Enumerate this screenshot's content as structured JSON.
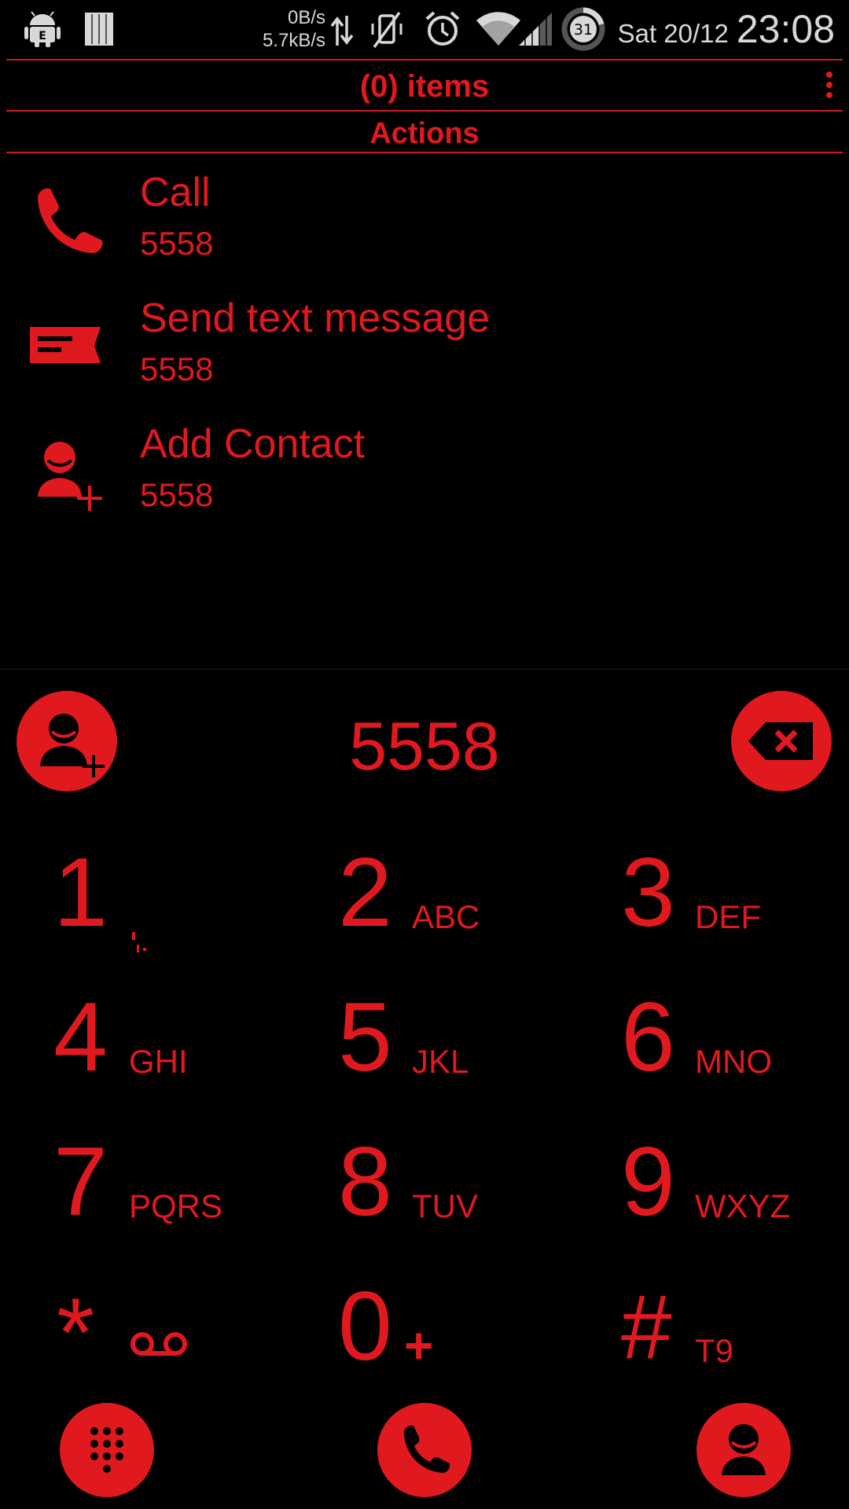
{
  "status_bar": {
    "net_up": "0B/s",
    "net_down": "5.7kB/s",
    "battery_level": "31",
    "date": "Sat 20/12",
    "time": "23:08",
    "icons": [
      "android-debug-icon",
      "sim-card-icon",
      "data-transfer-icon",
      "vibrate-icon",
      "alarm-icon",
      "wifi-icon",
      "signal-icon",
      "battery-icon"
    ]
  },
  "header": {
    "items_title": "(0) items",
    "actions_label": "Actions"
  },
  "actions": [
    {
      "title": "Call",
      "number": "5558",
      "icon": "phone-icon"
    },
    {
      "title": "Send text message",
      "number": "5558",
      "icon": "message-icon"
    },
    {
      "title": "Add Contact",
      "number": "5558",
      "icon": "add-contact-icon"
    }
  ],
  "dialer": {
    "entered_number": "5558",
    "left_button_icon": "add-contact-icon",
    "right_button_icon": "backspace-icon"
  },
  "keypad": [
    {
      "digit": "1",
      "letters": "",
      "sub_icon": "voicemail-none"
    },
    {
      "digit": "2",
      "letters": "ABC"
    },
    {
      "digit": "3",
      "letters": "DEF"
    },
    {
      "digit": "4",
      "letters": "GHI"
    },
    {
      "digit": "5",
      "letters": "JKL"
    },
    {
      "digit": "6",
      "letters": "MNO"
    },
    {
      "digit": "7",
      "letters": "PQRS"
    },
    {
      "digit": "8",
      "letters": "TUV"
    },
    {
      "digit": "9",
      "letters": "WXYZ"
    },
    {
      "digit": "*",
      "letters": "",
      "sub_icon": "voicemail-icon"
    },
    {
      "digit": "0",
      "letters": "+"
    },
    {
      "digit": "#",
      "letters": "T9"
    }
  ],
  "bottom_bar": {
    "icons": [
      "dialpad-icon",
      "call-icon",
      "contacts-icon"
    ]
  },
  "colors": {
    "accent": "#e0191f",
    "background": "#000000",
    "status_text": "#d8d8d8"
  }
}
